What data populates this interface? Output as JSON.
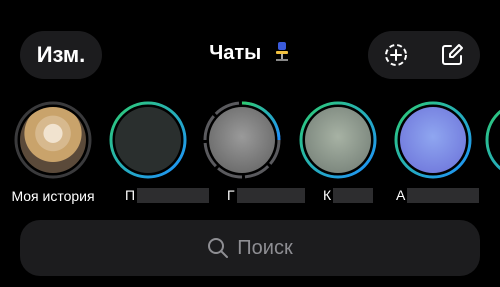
{
  "header": {
    "edit_label": "Изм.",
    "title": "Чаты"
  },
  "stories": [
    {
      "label": "Моя история"
    },
    {
      "label": "П"
    },
    {
      "label": "Г"
    },
    {
      "label": "К"
    },
    {
      "label": "А"
    }
  ],
  "search": {
    "placeholder": "Поиск"
  },
  "colors": {
    "accent_ring_start": "#2ecc71",
    "accent_ring_end": "#1e90ff",
    "surface": "#1c1c1e",
    "placeholder": "#8e8e93"
  },
  "icons": [
    "add-story-icon",
    "compose-icon",
    "search-icon"
  ]
}
